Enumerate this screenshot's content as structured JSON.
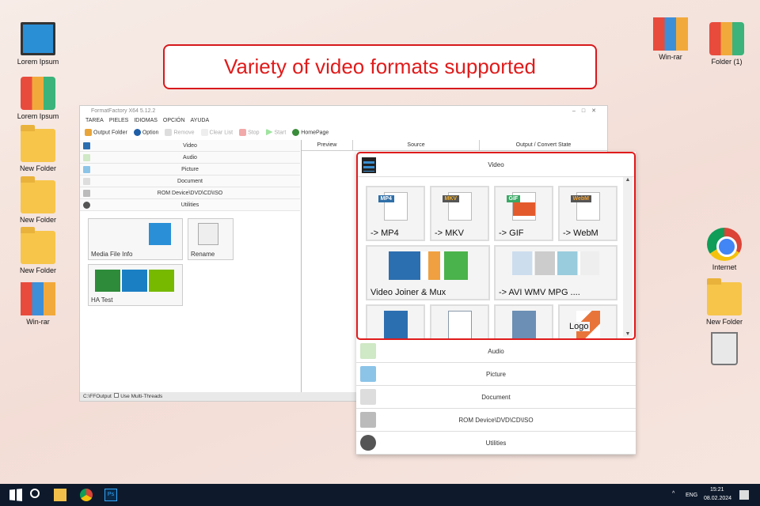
{
  "banner": "Variety of video formats supported",
  "desktop": {
    "left": [
      "Lorem Ipsum",
      "Lorem Ipsum",
      "New Folder",
      "New Folder",
      "New Folder",
      "Win-rar"
    ],
    "right": [
      "Win-rar",
      "Folder (1)",
      "Internet",
      "New Folder"
    ]
  },
  "app": {
    "title": "FormatFactory X64 5.12.2",
    "menu": [
      "TAREA",
      "PIELES",
      "IDIOMAS",
      "OPCIÓN",
      "AYUDA"
    ],
    "toolbar": {
      "output_folder": "Output Folder",
      "option": "Option",
      "remove": "Remove",
      "clear_list": "Clear List",
      "stop": "Stop",
      "start": "Start",
      "homepage": "HomePage"
    },
    "categories": [
      "Video",
      "Audio",
      "Picture",
      "Document",
      "ROM Device\\DVD\\CD\\ISO",
      "Utilities"
    ],
    "tiles": [
      "Media File Info",
      "Rename",
      "HA Test"
    ],
    "columns": [
      "Preview",
      "Source",
      "Output / Convert State"
    ],
    "status": {
      "path": "C:\\FFOutput",
      "multithread": "Use Multi-Threads"
    }
  },
  "zoom": {
    "header": "Video",
    "tiles": [
      "-> MP4",
      "-> MKV",
      "-> GIF",
      "-> WebM",
      "Video Joiner & Mux",
      "-> AVI WMV MPG ....",
      "",
      "",
      "",
      "Logo"
    ],
    "tags": [
      "MP4",
      "MKV",
      "GIF",
      "WebM"
    ],
    "categories": [
      "Audio",
      "Picture",
      "Document",
      "ROM Device\\DVD\\CD\\ISO",
      "Utilities"
    ]
  },
  "taskbar": {
    "lang": "ENG",
    "time": "15:21",
    "date": "08.02.2024"
  }
}
